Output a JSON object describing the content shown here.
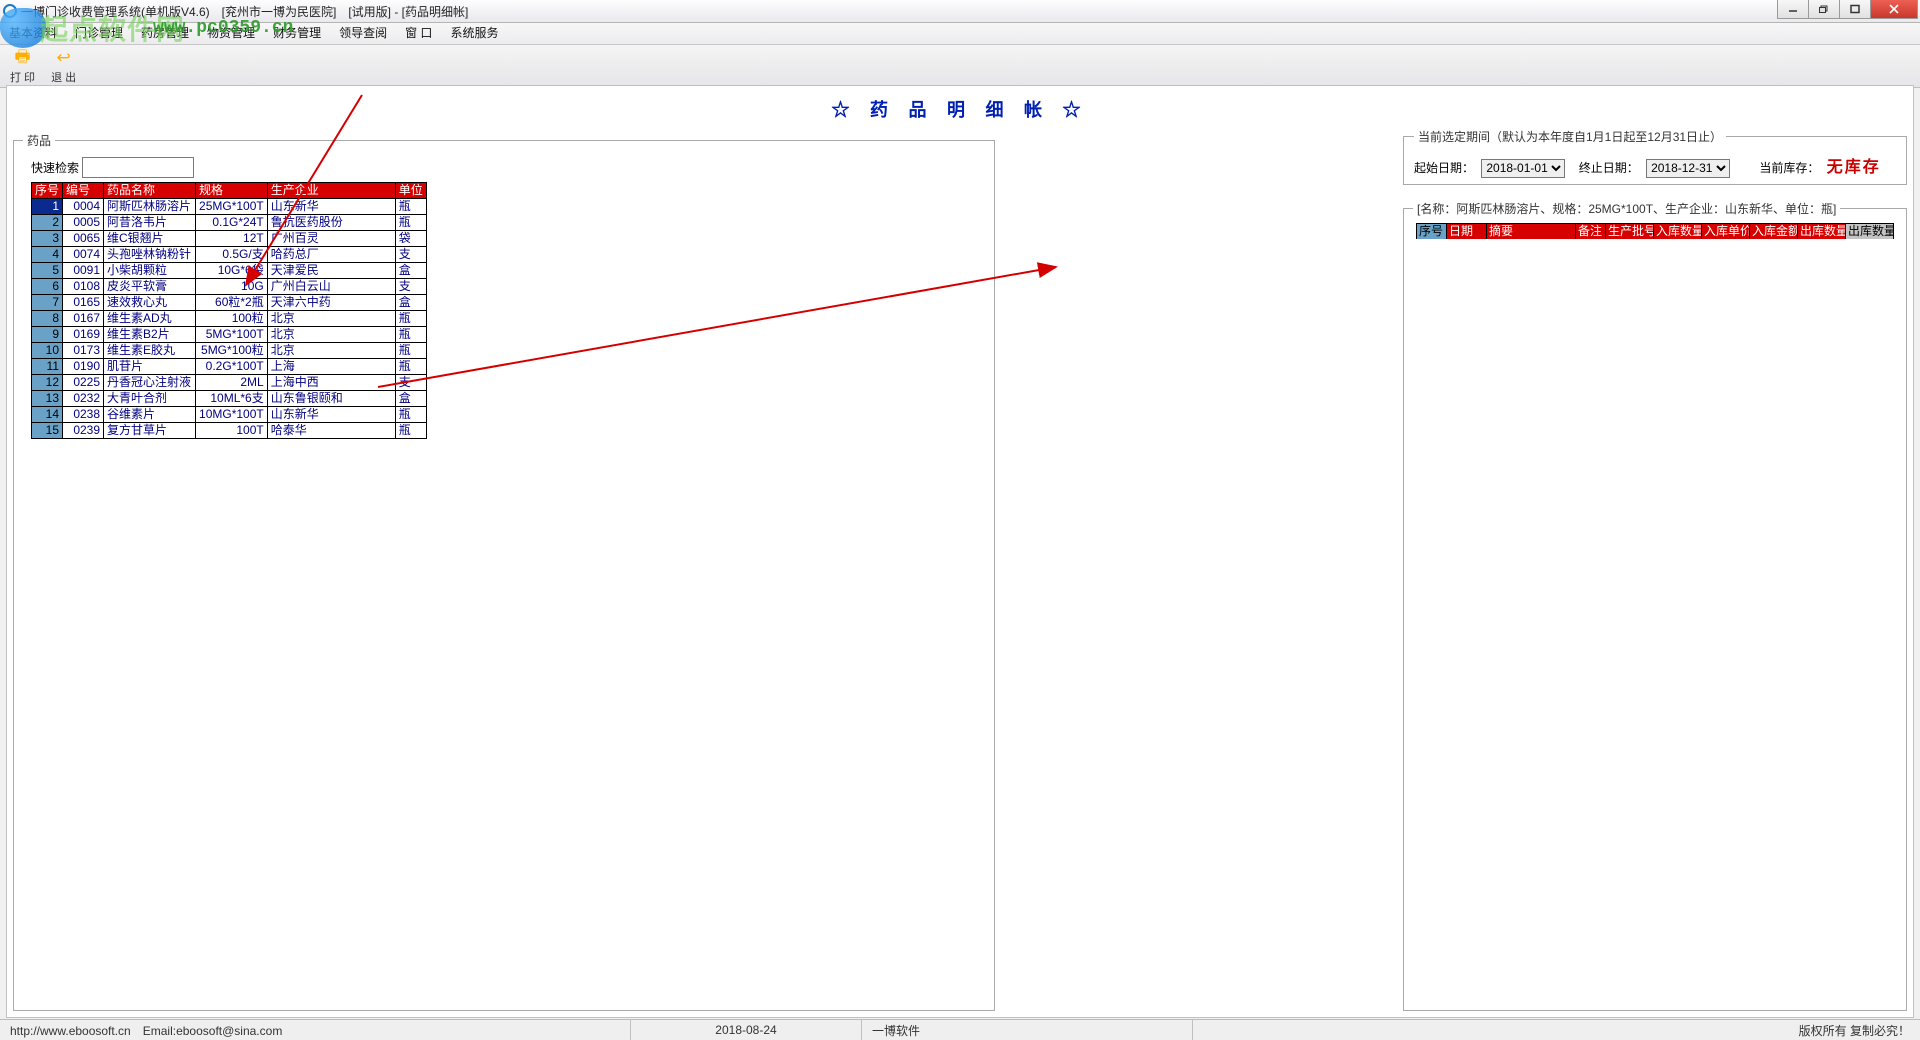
{
  "titlebar": "一博门诊收费管理系统(单机版V4.6)　[兖州市一博为民医院]　[试用版] - [药品明细帐]",
  "menubar": [
    "基本资料",
    "门诊管理",
    "药房管理",
    "物资管理",
    "财务管理",
    "领导查阅",
    "窗 口",
    "系统服务"
  ],
  "watermark": {
    "brand": "起点软件网",
    "url": "www.pc0359.cn"
  },
  "toolbar": {
    "print": "打 印",
    "exit": "退 出"
  },
  "page_title": "☆ 药 品 明 细 帐 ☆",
  "left_legend": "药品",
  "search_label": "快速检索",
  "drug_headers": [
    "序号",
    "编号",
    "药品名称",
    "规格",
    "生产企业",
    "单位"
  ],
  "drug_rows": [
    {
      "i": 1,
      "code": "0004",
      "name": "阿斯匹林肠溶片",
      "spec": "25MG*100T",
      "mfr": "山东新华",
      "unit": "瓶",
      "sel": true
    },
    {
      "i": 2,
      "code": "0005",
      "name": "阿昔洛韦片",
      "spec": "0.1G*24T",
      "mfr": "鲁抗医药股份",
      "unit": "瓶"
    },
    {
      "i": 3,
      "code": "0065",
      "name": "维C银翘片",
      "spec": "12T",
      "mfr": "广州百灵",
      "unit": "袋"
    },
    {
      "i": 4,
      "code": "0074",
      "name": "头孢唑林钠粉针",
      "spec": "0.5G/支",
      "mfr": "哈药总厂",
      "unit": "支"
    },
    {
      "i": 5,
      "code": "0091",
      "name": "小柴胡颗粒",
      "spec": "10G*6袋",
      "mfr": "天津爱民",
      "unit": "盒"
    },
    {
      "i": 6,
      "code": "0108",
      "name": "皮炎平软膏",
      "spec": "10G",
      "mfr": "广州白云山",
      "unit": "支"
    },
    {
      "i": 7,
      "code": "0165",
      "name": "速效救心丸",
      "spec": "60粒*2瓶",
      "mfr": "天津六中药",
      "unit": "盒"
    },
    {
      "i": 8,
      "code": "0167",
      "name": "维生素AD丸",
      "spec": "100粒",
      "mfr": "北京",
      "unit": "瓶"
    },
    {
      "i": 9,
      "code": "0169",
      "name": "维生素B2片",
      "spec": "5MG*100T",
      "mfr": "北京",
      "unit": "瓶"
    },
    {
      "i": 10,
      "code": "0173",
      "name": "维生素E胶丸",
      "spec": "5MG*100粒",
      "mfr": "北京",
      "unit": "瓶"
    },
    {
      "i": 11,
      "code": "0190",
      "name": "肌苷片",
      "spec": "0.2G*100T",
      "mfr": "上海",
      "unit": "瓶"
    },
    {
      "i": 12,
      "code": "0225",
      "name": "丹香冠心注射液",
      "spec": "2ML",
      "mfr": "上海中西",
      "unit": "支"
    },
    {
      "i": 13,
      "code": "0232",
      "name": "大青叶合剂",
      "spec": "10ML*6支",
      "mfr": "山东鲁银颐和",
      "unit": "盒"
    },
    {
      "i": 14,
      "code": "0238",
      "name": "谷维素片",
      "spec": "10MG*100T",
      "mfr": "山东新华",
      "unit": "瓶"
    },
    {
      "i": 15,
      "code": "0239",
      "name": "复方甘草片",
      "spec": "100T",
      "mfr": "哈泰华",
      "unit": "瓶"
    }
  ],
  "period": {
    "legend": "当前选定期间（默认为本年度自1月1日起至12月31日止）",
    "start_label": "起始日期：",
    "start": "2018-01-01",
    "end_label": "终止日期：",
    "end": "2018-12-31",
    "stock_label": "当前库存：",
    "stock_value": "无库存"
  },
  "detail": {
    "legend": "[名称：阿斯匹林肠溶片、规格：25MG*100T、生产企业：山东新华、单位：瓶]",
    "headers": [
      "序号",
      "日期",
      "摘要",
      "备注",
      "生产批号",
      "入库数量",
      "入库单价",
      "入库金额",
      "出库数量",
      "出库数量"
    ]
  },
  "statusbar": {
    "url": "http://www.eboosoft.cn　Email:eboosoft@sina.com",
    "date": "2018-08-24",
    "vendor": "一博软件",
    "copyright": "版权所有 复制必究！"
  }
}
